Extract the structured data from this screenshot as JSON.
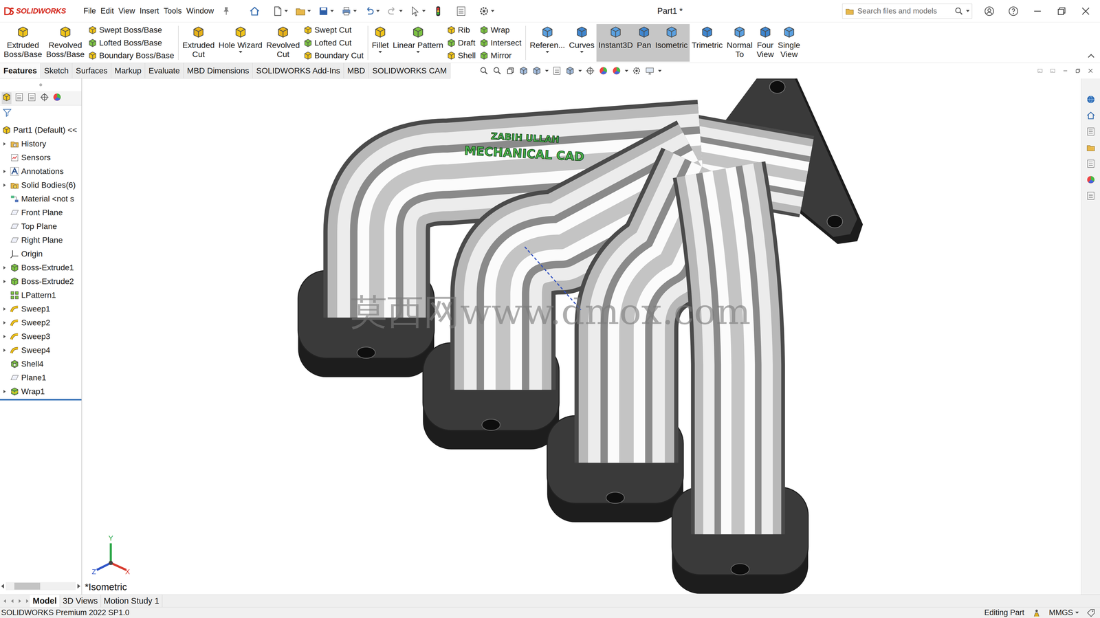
{
  "window": {
    "title": "Part1 *"
  },
  "logo": {
    "text": "SOLIDWORKS"
  },
  "menu": [
    "File",
    "Edit",
    "View",
    "Insert",
    "Tools",
    "Window"
  ],
  "search": {
    "placeholder": "Search files and models"
  },
  "ribbon": {
    "groups": [
      {
        "buttons": [
          {
            "kind": "large",
            "lines": [
              "Extruded",
              "Boss/Base"
            ],
            "selected": false,
            "has_menu": false
          },
          {
            "kind": "large",
            "lines": [
              "Revolved",
              "Boss/Base"
            ],
            "selected": false,
            "has_menu": false
          },
          {
            "kind": "stack",
            "items": [
              {
                "label": "Swept Boss/Base",
                "selected": false
              },
              {
                "label": "Lofted Boss/Base",
                "selected": false
              },
              {
                "label": "Boundary Boss/Base",
                "selected": false
              }
            ]
          }
        ]
      },
      {
        "buttons": [
          {
            "kind": "large",
            "lines": [
              "Extruded",
              "Cut"
            ],
            "selected": false,
            "has_menu": false
          },
          {
            "kind": "large",
            "lines": [
              "Hole Wizard"
            ],
            "selected": false,
            "has_menu": true
          },
          {
            "kind": "large",
            "lines": [
              "Revolved",
              "Cut"
            ],
            "selected": false,
            "has_menu": false
          },
          {
            "kind": "stack",
            "items": [
              {
                "label": "Swept Cut",
                "selected": false
              },
              {
                "label": "Lofted Cut",
                "selected": false
              },
              {
                "label": "Boundary Cut",
                "selected": false
              }
            ]
          }
        ]
      },
      {
        "buttons": [
          {
            "kind": "large",
            "lines": [
              "Fillet"
            ],
            "selected": false,
            "has_menu": true
          },
          {
            "kind": "large",
            "lines": [
              "Linear Pattern"
            ],
            "selected": false,
            "has_menu": true
          },
          {
            "kind": "stack",
            "items": [
              {
                "label": "Rib",
                "selected": false
              },
              {
                "label": "Draft",
                "selected": false
              },
              {
                "label": "Shell",
                "selected": false
              }
            ]
          },
          {
            "kind": "stack",
            "items": [
              {
                "label": "Wrap",
                "selected": false
              },
              {
                "label": "Intersect",
                "selected": false
              },
              {
                "label": "Mirror",
                "selected": false
              }
            ]
          }
        ]
      },
      {
        "buttons": [
          {
            "kind": "large",
            "lines": [
              "Referen..."
            ],
            "selected": false,
            "has_menu": true
          },
          {
            "kind": "large",
            "lines": [
              "Curves"
            ],
            "selected": false,
            "has_menu": true
          },
          {
            "kind": "large",
            "lines": [
              "Instant3D"
            ],
            "selected": true,
            "has_menu": false
          },
          {
            "kind": "large",
            "lines": [
              "Pan"
            ],
            "selected": true,
            "has_menu": false
          },
          {
            "kind": "large",
            "lines": [
              "Isometric"
            ],
            "selected": true,
            "has_menu": false
          },
          {
            "kind": "large",
            "lines": [
              "Trimetric"
            ],
            "selected": false,
            "has_menu": false
          },
          {
            "kind": "large",
            "lines": [
              "Normal",
              "To"
            ],
            "selected": false,
            "has_menu": false
          },
          {
            "kind": "large",
            "lines": [
              "Four",
              "View"
            ],
            "selected": false,
            "has_menu": false
          },
          {
            "kind": "large",
            "lines": [
              "Single",
              "View"
            ],
            "selected": false,
            "has_menu": false
          }
        ]
      }
    ]
  },
  "tabs": [
    {
      "label": "Features",
      "selected": true
    },
    {
      "label": "Sketch",
      "selected": false
    },
    {
      "label": "Surfaces",
      "selected": false
    },
    {
      "label": "Markup",
      "selected": false
    },
    {
      "label": "Evaluate",
      "selected": false
    },
    {
      "label": "MBD Dimensions",
      "selected": false
    },
    {
      "label": "SOLIDWORKS Add-Ins",
      "selected": false
    },
    {
      "label": "MBD",
      "selected": false
    },
    {
      "label": "SOLIDWORKS CAM",
      "selected": false
    }
  ],
  "feature_tree": {
    "items": [
      {
        "label": "Part1 (Default) <<",
        "kind": "part",
        "expandable": false,
        "expanded": false
      },
      {
        "label": "History",
        "kind": "history",
        "expandable": true,
        "expanded": false
      },
      {
        "label": "Sensors",
        "kind": "sensor",
        "expandable": false,
        "expanded": false
      },
      {
        "label": "Annotations",
        "kind": "annotation",
        "expandable": true,
        "expanded": false
      },
      {
        "label": "Solid Bodies(6)",
        "kind": "bodies",
        "expandable": true,
        "expanded": false
      },
      {
        "label": "Material <not s",
        "kind": "material",
        "expandable": false,
        "expanded": false
      },
      {
        "label": "Front Plane",
        "kind": "plane",
        "expandable": false,
        "expanded": false
      },
      {
        "label": "Top Plane",
        "kind": "plane",
        "expandable": false,
        "expanded": false
      },
      {
        "label": "Right Plane",
        "kind": "plane",
        "expandable": false,
        "expanded": false
      },
      {
        "label": "Origin",
        "kind": "origin",
        "expandable": false,
        "expanded": false
      },
      {
        "label": "Boss-Extrude1",
        "kind": "extrude",
        "expandable": true,
        "expanded": false
      },
      {
        "label": "Boss-Extrude2",
        "kind": "extrude",
        "expandable": true,
        "expanded": false
      },
      {
        "label": "LPattern1",
        "kind": "pattern",
        "expandable": false,
        "expanded": false
      },
      {
        "label": "Sweep1",
        "kind": "sweep",
        "expandable": true,
        "expanded": false
      },
      {
        "label": "Sweep2",
        "kind": "sweep",
        "expandable": true,
        "expanded": false
      },
      {
        "label": "Sweep3",
        "kind": "sweep",
        "expandable": true,
        "expanded": false
      },
      {
        "label": "Sweep4",
        "kind": "sweep",
        "expandable": true,
        "expanded": false
      },
      {
        "label": "Shell4",
        "kind": "shell",
        "expandable": false,
        "expanded": false
      },
      {
        "label": "Plane1",
        "kind": "plane",
        "expandable": false,
        "expanded": false
      },
      {
        "label": "Wrap1",
        "kind": "wrap",
        "expandable": true,
        "expanded": false
      }
    ]
  },
  "viewport": {
    "view_label": "*Isometric",
    "triad": [
      "Y",
      "Z",
      "X"
    ],
    "model_text": [
      "ZABIH ULLAH",
      "MECHANICAL CAD"
    ],
    "watermark": "莫西网www.dmox.com"
  },
  "bottom_tabs": [
    {
      "label": "Model",
      "selected": true
    },
    {
      "label": "3D Views",
      "selected": false
    },
    {
      "label": "Motion Study 1",
      "selected": false
    }
  ],
  "status_bar": {
    "product": "SOLIDWORKS Premium 2022 SP1.0",
    "mode": "Editing Part",
    "units": "MMGS"
  }
}
